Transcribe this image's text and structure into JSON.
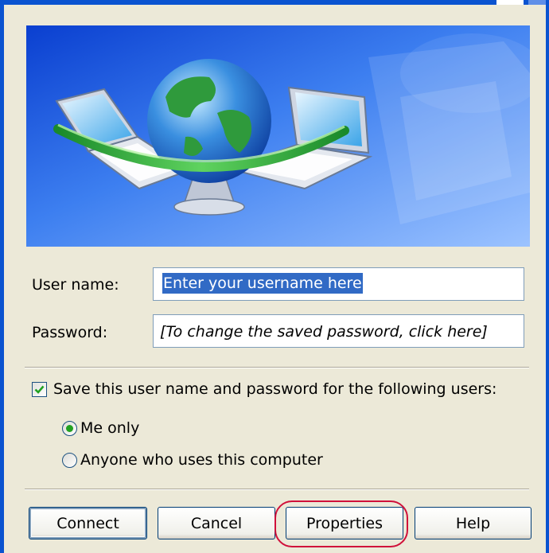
{
  "form": {
    "username_label": "User name:",
    "username_value": "Enter your username here",
    "password_label": "Password:",
    "password_hint": "[To change the saved password, click here]",
    "save_checkbox_label": "Save this user name and password for the following users:",
    "save_checked": true,
    "radio_me_only": "Me only",
    "radio_anyone": "Anyone who uses this computer",
    "selected_radio": "Me only"
  },
  "buttons": {
    "connect": "Connect",
    "cancel": "Cancel",
    "properties": "Properties",
    "help": "Help"
  },
  "icons": {
    "banner": "network-connection-illustration",
    "checkbox": "checkmark-icon",
    "radio": "radio-dot-icon"
  },
  "colors": {
    "dialog_bg": "#ece9d8",
    "window_border": "#0a53d0",
    "selection": "#316ac5",
    "highlight_ring": "#d0103a",
    "radio_dot": "#21a121"
  }
}
